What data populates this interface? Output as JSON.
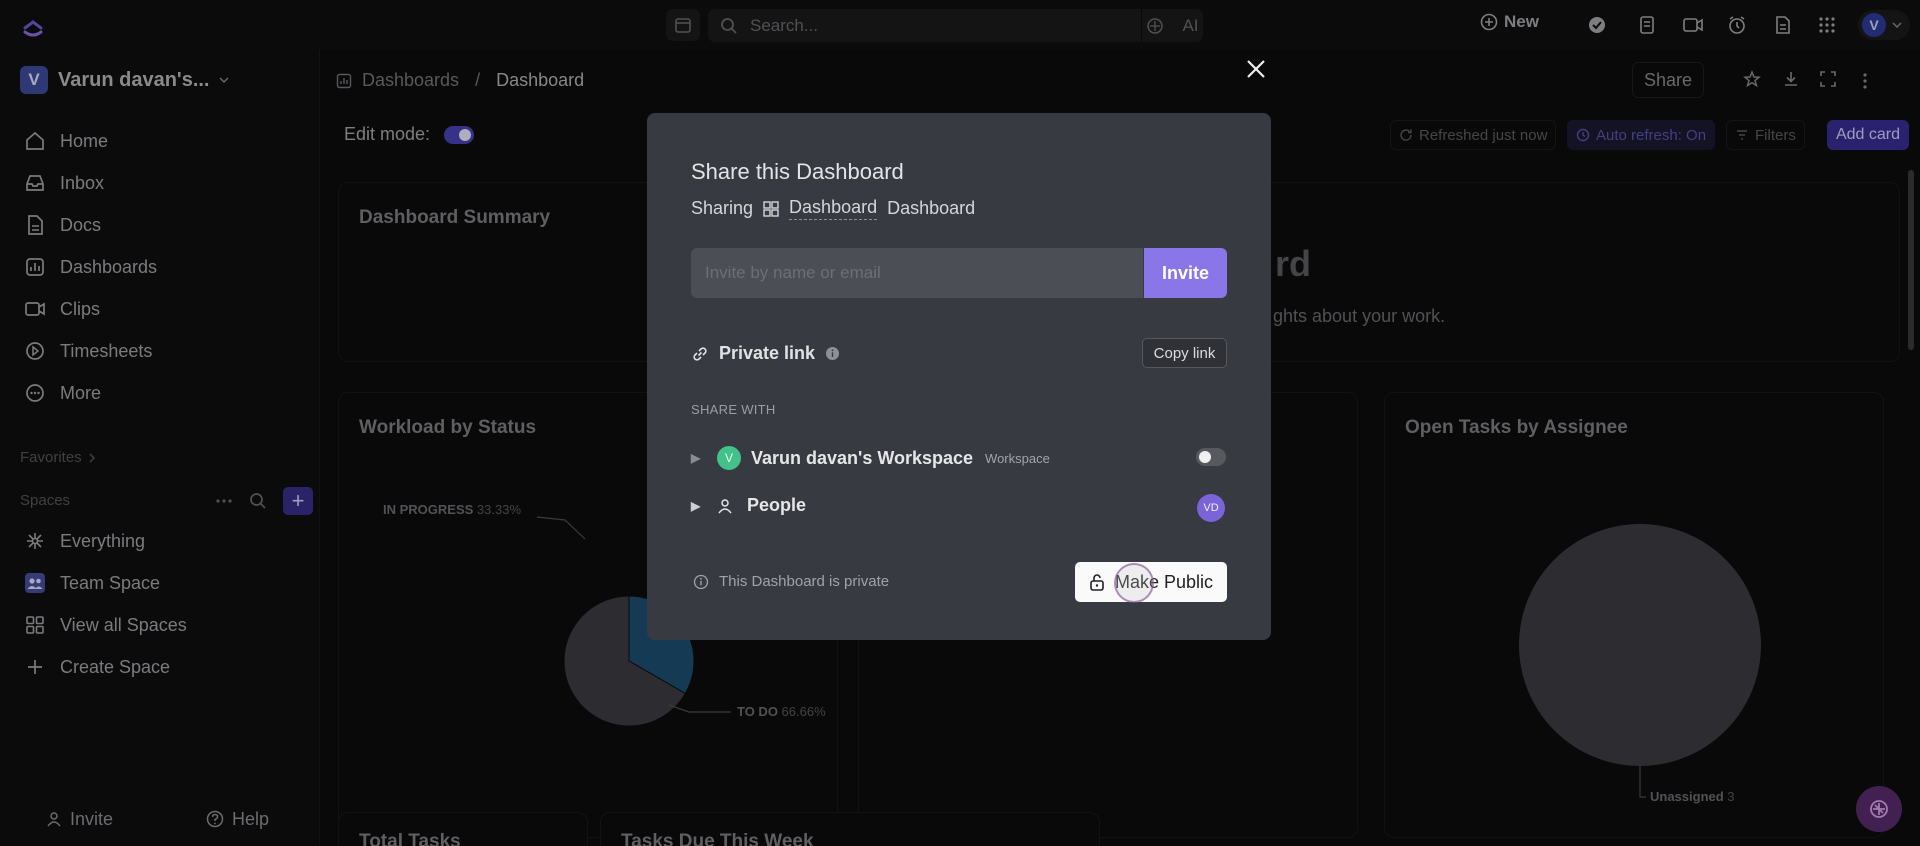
{
  "topbar": {
    "search_placeholder": "Search...",
    "ai_label": "AI",
    "new_label": "New",
    "avatar_initial": "V"
  },
  "sidebar": {
    "workspace_initial": "V",
    "workspace_name": "Varun davan's...",
    "items": [
      {
        "label": "Home",
        "icon": "home-icon"
      },
      {
        "label": "Inbox",
        "icon": "inbox-icon"
      },
      {
        "label": "Docs",
        "icon": "docs-icon"
      },
      {
        "label": "Dashboards",
        "icon": "dashboards-icon"
      },
      {
        "label": "Clips",
        "icon": "clips-icon"
      },
      {
        "label": "Timesheets",
        "icon": "timesheets-icon"
      },
      {
        "label": "More",
        "icon": "more-icon"
      }
    ],
    "favorites_label": "Favorites",
    "spaces_label": "Spaces",
    "spaces": [
      {
        "label": "Everything",
        "icon": "everything-icon"
      },
      {
        "label": "Team Space",
        "icon": "team-space-icon"
      },
      {
        "label": "View all Spaces",
        "icon": "grid-icon"
      },
      {
        "label": "Create Space",
        "icon": "plus-icon"
      }
    ],
    "invite_label": "Invite",
    "help_label": "Help"
  },
  "header": {
    "breadcrumb_parent": "Dashboards",
    "breadcrumb_sep": "/",
    "breadcrumb_current": "Dashboard",
    "share_label": "Share",
    "edit_mode_label": "Edit mode:",
    "refreshed_label": "Refreshed just now",
    "auto_refresh_label": "Auto refresh: On",
    "filters_label": "Filters",
    "add_card_label": "Add card"
  },
  "cards": {
    "summary_title": "Dashboard Summary",
    "summary_partial_heading": "rd",
    "summary_partial_text": "ghts about your work.",
    "workload_title": "Workload by Status",
    "open_tasks_title": "Open Tasks by Assignee",
    "total_tasks_title": "Total Tasks",
    "due_week_title": "Tasks Due This Week"
  },
  "chart_data": [
    {
      "type": "pie",
      "title": "Workload by Status",
      "slices": [
        {
          "label": "IN PROGRESS",
          "value": 33.33,
          "display": "33.33%",
          "color": "#1b4e70"
        },
        {
          "label": "TO DO",
          "value": 66.66,
          "display": "66.66%",
          "color": "#3c3d42"
        }
      ]
    },
    {
      "type": "pie",
      "title": "Open Tasks by Assignee",
      "slices": [
        {
          "label": "Unassigned",
          "value": 3,
          "display": "3",
          "color": "#3c3d42"
        }
      ]
    }
  ],
  "modal": {
    "title": "Share this Dashboard",
    "sharing_label": "Sharing",
    "sharing_link": "Dashboard",
    "sharing_name": "Dashboard",
    "invite_placeholder": "Invite by name or email",
    "invite_value": "",
    "invite_button": "Invite",
    "private_link_label": "Private link",
    "copy_link_label": "Copy link",
    "share_with_label": "SHARE WITH",
    "workspace_row": {
      "initial": "V",
      "name": "Varun davan's Workspace",
      "badge": "Workspace",
      "toggle": false
    },
    "people_row": {
      "name": "People",
      "avatar": "VD"
    },
    "private_note": "This Dashboard is private",
    "make_public_label": "Make Public"
  },
  "colors": {
    "accent": "#8a76e8",
    "modal_bg": "#373a40",
    "brand_purple": "#382e93"
  }
}
